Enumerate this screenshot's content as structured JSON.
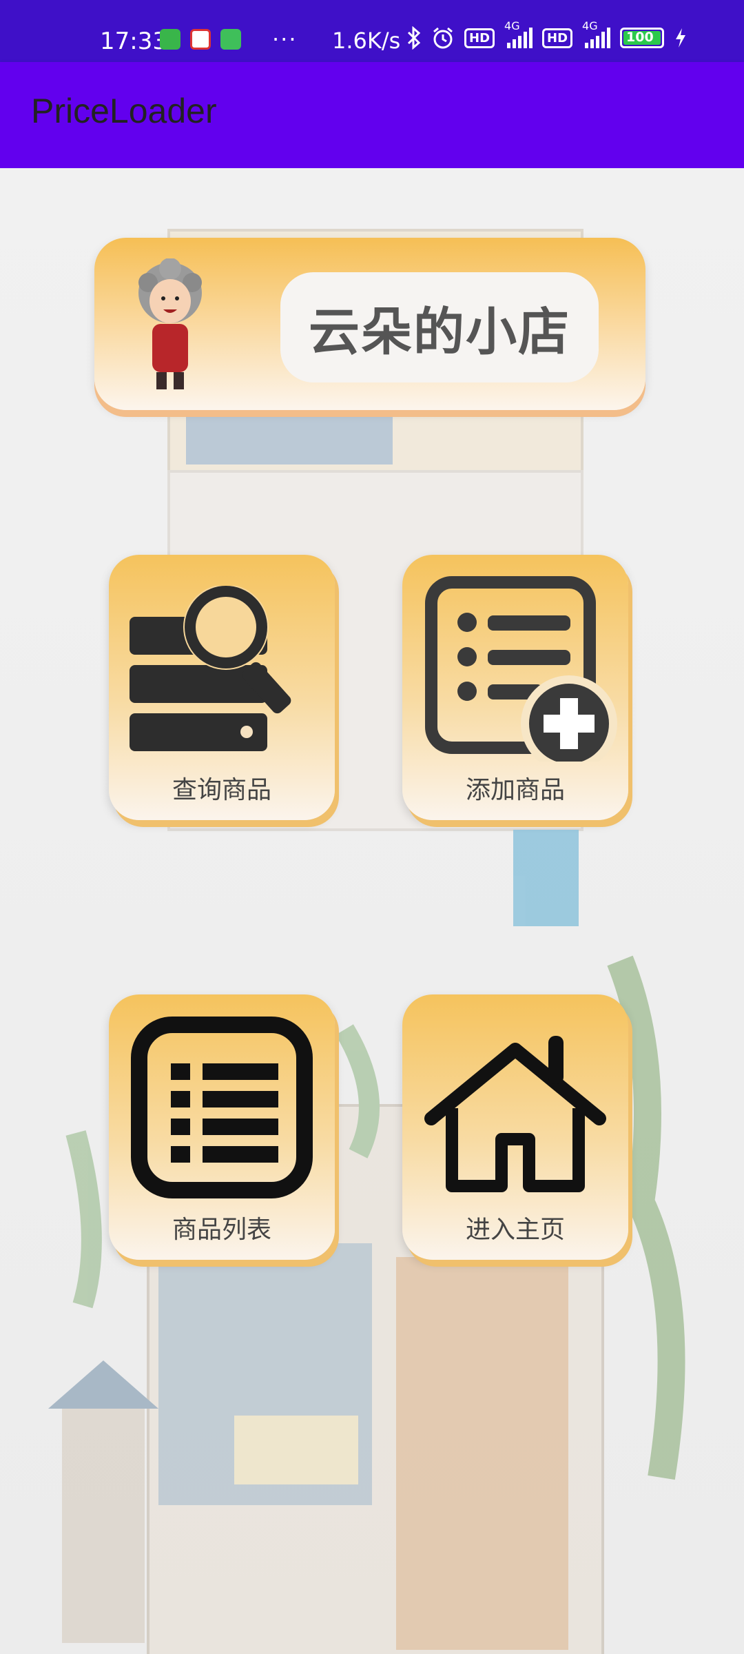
{
  "status_bar": {
    "time": "17:33",
    "dots": "···",
    "speed": "1.6K/s",
    "hd1": "HD",
    "hd2": "HD",
    "net1": "4G",
    "net2": "4G",
    "battery": "100"
  },
  "app_bar": {
    "title": "PriceLoader"
  },
  "banner": {
    "shop_name": "云朵的小店"
  },
  "menu": {
    "search_label": "查询商品",
    "add_label": "添加商品",
    "list_label": "商品列表",
    "home_label": "进入主页"
  },
  "colors": {
    "status_bar": "#3f10c8",
    "app_bar": "#6200ee",
    "card_top": "#f5c35d",
    "card_bottom": "#fbf4ec"
  },
  "icons": [
    "server-search-icon",
    "list-add-icon",
    "list-icon",
    "home-icon"
  ]
}
